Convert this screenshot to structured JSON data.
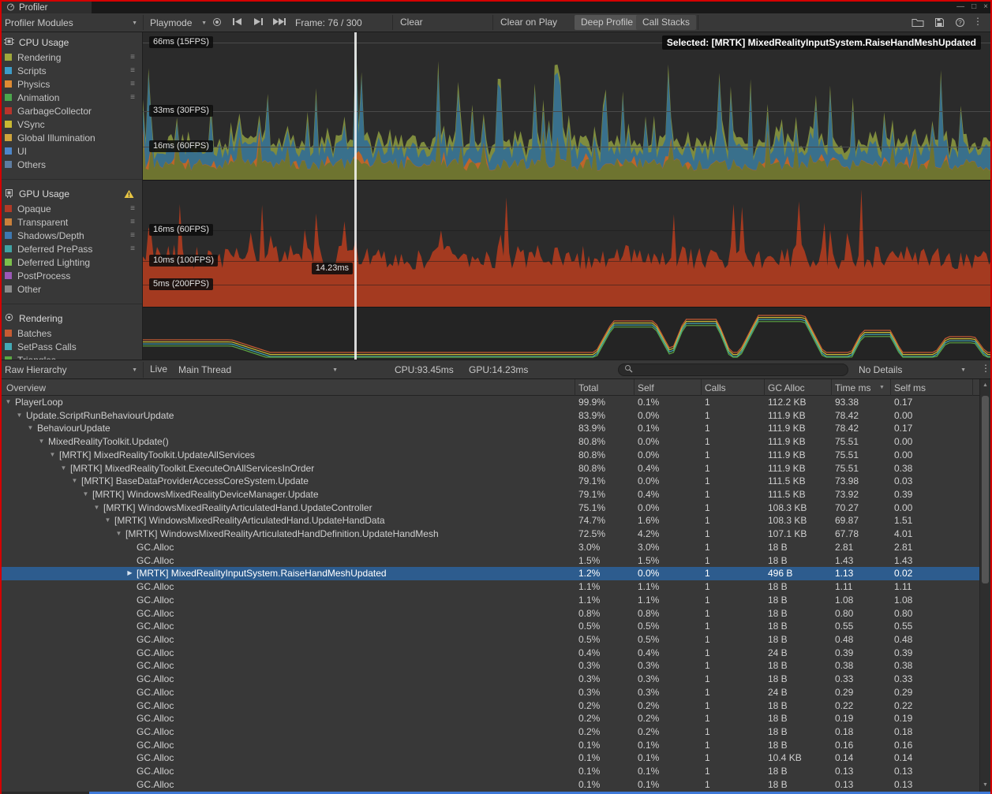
{
  "window": {
    "title": "Profiler"
  },
  "toolbar": {
    "profiler_modules": "Profiler Modules",
    "playmode": "Playmode",
    "frame": "Frame: 76 / 300",
    "clear": "Clear",
    "clear_on_play": "Clear on Play",
    "deep_profile": "Deep Profile",
    "call_stacks": "Call Stacks"
  },
  "modules": [
    {
      "name": "CPU Usage",
      "icon": "cpu-icon",
      "warning": false,
      "items": [
        {
          "label": "Rendering",
          "color": "#A0A83C",
          "handle": true
        },
        {
          "label": "Scripts",
          "color": "#3D9CC8",
          "handle": true
        },
        {
          "label": "Physics",
          "color": "#DE8A33",
          "handle": true
        },
        {
          "label": "Animation",
          "color": "#4CA64C",
          "handle": true
        },
        {
          "label": "GarbageCollector",
          "color": "#B8342C",
          "handle": false
        },
        {
          "label": "VSync",
          "color": "#C8B832",
          "handle": false
        },
        {
          "label": "Global Illumination",
          "color": "#CFA43C",
          "handle": false
        },
        {
          "label": "UI",
          "color": "#4E86C9",
          "handle": false
        },
        {
          "label": "Others",
          "color": "#5E7CA0",
          "handle": false
        }
      ]
    },
    {
      "name": "GPU Usage",
      "icon": "gpu-icon",
      "warning": true,
      "items": [
        {
          "label": "Opaque",
          "color": "#B03A26",
          "handle": true
        },
        {
          "label": "Transparent",
          "color": "#C9803C",
          "handle": true
        },
        {
          "label": "Shadows/Depth",
          "color": "#3E78B0",
          "handle": true
        },
        {
          "label": "Deferred PrePass",
          "color": "#41A3A3",
          "handle": true
        },
        {
          "label": "Deferred Lighting",
          "color": "#7CBF4C",
          "handle": false
        },
        {
          "label": "PostProcess",
          "color": "#9B59B6",
          "handle": false
        },
        {
          "label": "Other",
          "color": "#8A8A8A",
          "handle": false
        }
      ]
    },
    {
      "name": "Rendering",
      "icon": "rendering-icon",
      "warning": false,
      "items": [
        {
          "label": "Batches",
          "color": "#C65B33",
          "handle": false
        },
        {
          "label": "SetPass Calls",
          "color": "#44AAB5",
          "handle": false
        },
        {
          "label": "Triangles",
          "color": "#5CA643",
          "handle": false
        }
      ]
    }
  ],
  "charts": {
    "selected_sample": "Selected: [MRTK] MixedRealityInputSystem.RaiseHandMeshUpdated",
    "cpu_gridlines": [
      {
        "label": "66ms (15FPS)"
      },
      {
        "label": "33ms (30FPS)"
      },
      {
        "label": "16ms (60FPS)"
      }
    ],
    "gpu_gridlines": [
      {
        "label": "16ms (60FPS)"
      },
      {
        "label": "10ms (100FPS)"
      },
      {
        "label": "5ms (200FPS)"
      }
    ],
    "gpu_tooltip": "14.23ms",
    "selected_frame": 76,
    "total_frames": 300
  },
  "details_toolbar": {
    "hierarchy_mode": "Raw Hierarchy",
    "live": "Live",
    "thread": "Main Thread",
    "cpu_time": "CPU:93.45ms",
    "gpu_time": "GPU:14.23ms",
    "search_value": "",
    "details_mode": "No Details"
  },
  "table": {
    "columns": [
      "Overview",
      "Total",
      "Self",
      "Calls",
      "GC Alloc",
      "Time ms",
      "Self ms"
    ],
    "sorted_by": "Time ms",
    "rows": [
      {
        "label": "PlayerLoop",
        "indent": 0,
        "arrow": "down",
        "selected": false,
        "total": "99.9%",
        "self": "0.1%",
        "calls": "1",
        "gc_alloc": "112.2 KB",
        "time_ms": "93.38",
        "self_ms": "0.17"
      },
      {
        "label": "Update.ScriptRunBehaviourUpdate",
        "indent": 1,
        "arrow": "down",
        "selected": false,
        "total": "83.9%",
        "self": "0.0%",
        "calls": "1",
        "gc_alloc": "111.9 KB",
        "time_ms": "78.42",
        "self_ms": "0.00"
      },
      {
        "label": "BehaviourUpdate",
        "indent": 2,
        "arrow": "down",
        "selected": false,
        "total": "83.9%",
        "self": "0.1%",
        "calls": "1",
        "gc_alloc": "111.9 KB",
        "time_ms": "78.42",
        "self_ms": "0.17"
      },
      {
        "label": "MixedRealityToolkit.Update()",
        "indent": 3,
        "arrow": "down",
        "selected": false,
        "total": "80.8%",
        "self": "0.0%",
        "calls": "1",
        "gc_alloc": "111.9 KB",
        "time_ms": "75.51",
        "self_ms": "0.00"
      },
      {
        "label": "[MRTK] MixedRealityToolkit.UpdateAllServices",
        "indent": 4,
        "arrow": "down",
        "selected": false,
        "total": "80.8%",
        "self": "0.0%",
        "calls": "1",
        "gc_alloc": "111.9 KB",
        "time_ms": "75.51",
        "self_ms": "0.00"
      },
      {
        "label": "[MRTK] MixedRealityToolkit.ExecuteOnAllServicesInOrder",
        "indent": 5,
        "arrow": "down",
        "selected": false,
        "total": "80.8%",
        "self": "0.4%",
        "calls": "1",
        "gc_alloc": "111.9 KB",
        "time_ms": "75.51",
        "self_ms": "0.38"
      },
      {
        "label": "[MRTK] BaseDataProviderAccessCoreSystem.Update",
        "indent": 6,
        "arrow": "down",
        "selected": false,
        "total": "79.1%",
        "self": "0.0%",
        "calls": "1",
        "gc_alloc": "111.5 KB",
        "time_ms": "73.98",
        "self_ms": "0.03"
      },
      {
        "label": "[MRTK] WindowsMixedRealityDeviceManager.Update",
        "indent": 7,
        "arrow": "down",
        "selected": false,
        "total": "79.1%",
        "self": "0.4%",
        "calls": "1",
        "gc_alloc": "111.5 KB",
        "time_ms": "73.92",
        "self_ms": "0.39"
      },
      {
        "label": "[MRTK] WindowsMixedRealityArticulatedHand.UpdateController",
        "indent": 8,
        "arrow": "down",
        "selected": false,
        "total": "75.1%",
        "self": "0.0%",
        "calls": "1",
        "gc_alloc": "108.3 KB",
        "time_ms": "70.27",
        "self_ms": "0.00"
      },
      {
        "label": "[MRTK] WindowsMixedRealityArticulatedHand.UpdateHandData",
        "indent": 9,
        "arrow": "down",
        "selected": false,
        "total": "74.7%",
        "self": "1.6%",
        "calls": "1",
        "gc_alloc": "108.3 KB",
        "time_ms": "69.87",
        "self_ms": "1.51"
      },
      {
        "label": "[MRTK] WindowsMixedRealityArticulatedHandDefinition.UpdateHandMesh",
        "indent": 10,
        "arrow": "down",
        "selected": false,
        "total": "72.5%",
        "self": "4.2%",
        "calls": "1",
        "gc_alloc": "107.1 KB",
        "time_ms": "67.78",
        "self_ms": "4.01"
      },
      {
        "label": "GC.Alloc",
        "indent": 11,
        "arrow": "none",
        "selected": false,
        "total": "3.0%",
        "self": "3.0%",
        "calls": "1",
        "gc_alloc": "18 B",
        "time_ms": "2.81",
        "self_ms": "2.81"
      },
      {
        "label": "GC.Alloc",
        "indent": 11,
        "arrow": "none",
        "selected": false,
        "total": "1.5%",
        "self": "1.5%",
        "calls": "1",
        "gc_alloc": "18 B",
        "time_ms": "1.43",
        "self_ms": "1.43"
      },
      {
        "label": "[MRTK] MixedRealityInputSystem.RaiseHandMeshUpdated",
        "indent": 11,
        "arrow": "right",
        "selected": true,
        "total": "1.2%",
        "self": "0.0%",
        "calls": "1",
        "gc_alloc": "496 B",
        "time_ms": "1.13",
        "self_ms": "0.02"
      },
      {
        "label": "GC.Alloc",
        "indent": 11,
        "arrow": "none",
        "selected": false,
        "total": "1.1%",
        "self": "1.1%",
        "calls": "1",
        "gc_alloc": "18 B",
        "time_ms": "1.11",
        "self_ms": "1.11"
      },
      {
        "label": "GC.Alloc",
        "indent": 11,
        "arrow": "none",
        "selected": false,
        "total": "1.1%",
        "self": "1.1%",
        "calls": "1",
        "gc_alloc": "18 B",
        "time_ms": "1.08",
        "self_ms": "1.08"
      },
      {
        "label": "GC.Alloc",
        "indent": 11,
        "arrow": "none",
        "selected": false,
        "total": "0.8%",
        "self": "0.8%",
        "calls": "1",
        "gc_alloc": "18 B",
        "time_ms": "0.80",
        "self_ms": "0.80"
      },
      {
        "label": "GC.Alloc",
        "indent": 11,
        "arrow": "none",
        "selected": false,
        "total": "0.5%",
        "self": "0.5%",
        "calls": "1",
        "gc_alloc": "18 B",
        "time_ms": "0.55",
        "self_ms": "0.55"
      },
      {
        "label": "GC.Alloc",
        "indent": 11,
        "arrow": "none",
        "selected": false,
        "total": "0.5%",
        "self": "0.5%",
        "calls": "1",
        "gc_alloc": "18 B",
        "time_ms": "0.48",
        "self_ms": "0.48"
      },
      {
        "label": "GC.Alloc",
        "indent": 11,
        "arrow": "none",
        "selected": false,
        "total": "0.4%",
        "self": "0.4%",
        "calls": "1",
        "gc_alloc": "24 B",
        "time_ms": "0.39",
        "self_ms": "0.39"
      },
      {
        "label": "GC.Alloc",
        "indent": 11,
        "arrow": "none",
        "selected": false,
        "total": "0.3%",
        "self": "0.3%",
        "calls": "1",
        "gc_alloc": "18 B",
        "time_ms": "0.38",
        "self_ms": "0.38"
      },
      {
        "label": "GC.Alloc",
        "indent": 11,
        "arrow": "none",
        "selected": false,
        "total": "0.3%",
        "self": "0.3%",
        "calls": "1",
        "gc_alloc": "18 B",
        "time_ms": "0.33",
        "self_ms": "0.33"
      },
      {
        "label": "GC.Alloc",
        "indent": 11,
        "arrow": "none",
        "selected": false,
        "total": "0.3%",
        "self": "0.3%",
        "calls": "1",
        "gc_alloc": "24 B",
        "time_ms": "0.29",
        "self_ms": "0.29"
      },
      {
        "label": "GC.Alloc",
        "indent": 11,
        "arrow": "none",
        "selected": false,
        "total": "0.2%",
        "self": "0.2%",
        "calls": "1",
        "gc_alloc": "18 B",
        "time_ms": "0.22",
        "self_ms": "0.22"
      },
      {
        "label": "GC.Alloc",
        "indent": 11,
        "arrow": "none",
        "selected": false,
        "total": "0.2%",
        "self": "0.2%",
        "calls": "1",
        "gc_alloc": "18 B",
        "time_ms": "0.19",
        "self_ms": "0.19"
      },
      {
        "label": "GC.Alloc",
        "indent": 11,
        "arrow": "none",
        "selected": false,
        "total": "0.2%",
        "self": "0.2%",
        "calls": "1",
        "gc_alloc": "18 B",
        "time_ms": "0.18",
        "self_ms": "0.18"
      },
      {
        "label": "GC.Alloc",
        "indent": 11,
        "arrow": "none",
        "selected": false,
        "total": "0.1%",
        "self": "0.1%",
        "calls": "1",
        "gc_alloc": "18 B",
        "time_ms": "0.16",
        "self_ms": "0.16"
      },
      {
        "label": "GC.Alloc",
        "indent": 11,
        "arrow": "none",
        "selected": false,
        "total": "0.1%",
        "self": "0.1%",
        "calls": "1",
        "gc_alloc": "10.4 KB",
        "time_ms": "0.14",
        "self_ms": "0.14"
      },
      {
        "label": "GC.Alloc",
        "indent": 11,
        "arrow": "none",
        "selected": false,
        "total": "0.1%",
        "self": "0.1%",
        "calls": "1",
        "gc_alloc": "18 B",
        "time_ms": "0.13",
        "self_ms": "0.13"
      },
      {
        "label": "GC.Alloc",
        "indent": 11,
        "arrow": "none",
        "selected": false,
        "total": "0.1%",
        "self": "0.1%",
        "calls": "1",
        "gc_alloc": "18 B",
        "time_ms": "0.13",
        "self_ms": "0.13"
      }
    ]
  }
}
